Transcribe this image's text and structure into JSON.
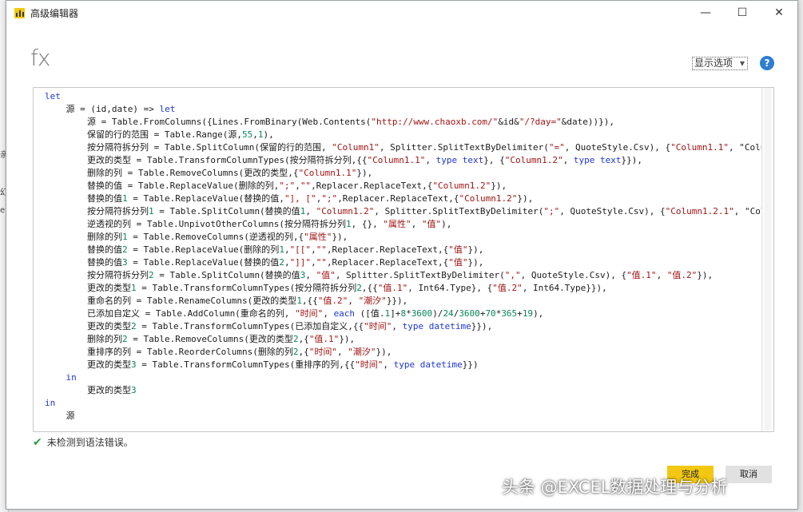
{
  "window": {
    "title": "高级编辑器"
  },
  "header": {
    "fx_label": "fx",
    "display_options": "显示选项",
    "help": "?"
  },
  "editor": {
    "lines": [
      {
        "indent": 0,
        "text": "let"
      },
      {
        "indent": 1,
        "text": "源 = (id,date) => let"
      },
      {
        "indent": 2,
        "text": "源 = Table.FromColumns({Lines.FromBinary(Web.Contents(\"http://www.chaoxb.com/\"&id&\"/?day=\"&date))}),"
      },
      {
        "indent": 2,
        "text": "保留的行的范围 = Table.Range(源,55,1),"
      },
      {
        "indent": 2,
        "text": "按分隔符拆分列 = Table.SplitColumn(保留的行的范围, \"Column1\", Splitter.SplitTextByDelimiter(\"=\", QuoteStyle.Csv), {\"Column1.1\", \"Colu"
      },
      {
        "indent": 2,
        "text": "更改的类型 = Table.TransformColumnTypes(按分隔符拆分列,{{\"Column1.1\", type text}, {\"Column1.2\", type text}}),"
      },
      {
        "indent": 2,
        "text": "删除的列 = Table.RemoveColumns(更改的类型,{\"Column1.1\"}),"
      },
      {
        "indent": 2,
        "text": "替换的值 = Table.ReplaceValue(删除的列,\";\",\"\",Replacer.ReplaceText,{\"Column1.2\"}),"
      },
      {
        "indent": 2,
        "text": "替换的值1 = Table.ReplaceValue(替换的值,\"], [\",\";\",Replacer.ReplaceText,{\"Column1.2\"}),"
      },
      {
        "indent": 2,
        "text": "按分隔符拆分列1 = Table.SplitColumn(替换的值1, \"Column1.2\", Splitter.SplitTextByDelimiter(\";\", QuoteStyle.Csv), {\"Column1.2.1\", \"Colu"
      },
      {
        "indent": 2,
        "text": "逆透视的列 = Table.UnpivotOtherColumns(按分隔符拆分列1, {}, \"属性\", \"值\"),"
      },
      {
        "indent": 2,
        "text": "删除的列1 = Table.RemoveColumns(逆透视的列,{\"属性\"}),"
      },
      {
        "indent": 2,
        "text": "替换的值2 = Table.ReplaceValue(删除的列1,\"[[\",\"\",Replacer.ReplaceText,{\"值\"}),"
      },
      {
        "indent": 2,
        "text": "替换的值3 = Table.ReplaceValue(替换的值2,\"]]\",\"\",Replacer.ReplaceText,{\"值\"}),"
      },
      {
        "indent": 2,
        "text": "按分隔符拆分列2 = Table.SplitColumn(替换的值3, \"值\", Splitter.SplitTextByDelimiter(\",\", QuoteStyle.Csv), {\"值.1\", \"值.2\"}),"
      },
      {
        "indent": 2,
        "text": "更改的类型1 = Table.TransformColumnTypes(按分隔符拆分列2,{{\"值.1\", Int64.Type}, {\"值.2\", Int64.Type}}),"
      },
      {
        "indent": 2,
        "text": "重命名的列 = Table.RenameColumns(更改的类型1,{{\"值.2\", \"潮汐\"}}),"
      },
      {
        "indent": 2,
        "text": "已添加自定义 = Table.AddColumn(重命名的列, \"时间\", each ([值.1]+8*3600)/24/3600+70*365+19),"
      },
      {
        "indent": 2,
        "text": "更改的类型2 = Table.TransformColumnTypes(已添加自定义,{{\"时间\", type datetime}}),"
      },
      {
        "indent": 2,
        "text": "删除的列2 = Table.RemoveColumns(更改的类型2,{\"值.1\"}),"
      },
      {
        "indent": 2,
        "text": "重排序的列 = Table.ReorderColumns(删除的列2,{\"时间\", \"潮汐\"}),"
      },
      {
        "indent": 2,
        "text": "更改的类型3 = Table.TransformColumnTypes(重排序的列,{{\"时间\", type datetime}})"
      },
      {
        "indent": 1,
        "text": "in"
      },
      {
        "indent": 2,
        "text": "更改的类型3"
      },
      {
        "indent": 0,
        "text": "in"
      },
      {
        "indent": 1,
        "text": "源"
      }
    ]
  },
  "status": {
    "text": "未检测到语法错误。"
  },
  "buttons": {
    "ok": "完成",
    "cancel": "取消"
  },
  "watermark": "头条 @EXCEL数据处理与分析",
  "background": {
    "chars": [
      "亲",
      "幻",
      "e"
    ]
  },
  "colors": {
    "keyword": "#1e35d6",
    "string": "#a31515",
    "number": "#098658",
    "accent": "#f2c811",
    "help": "#2f7dd1"
  }
}
